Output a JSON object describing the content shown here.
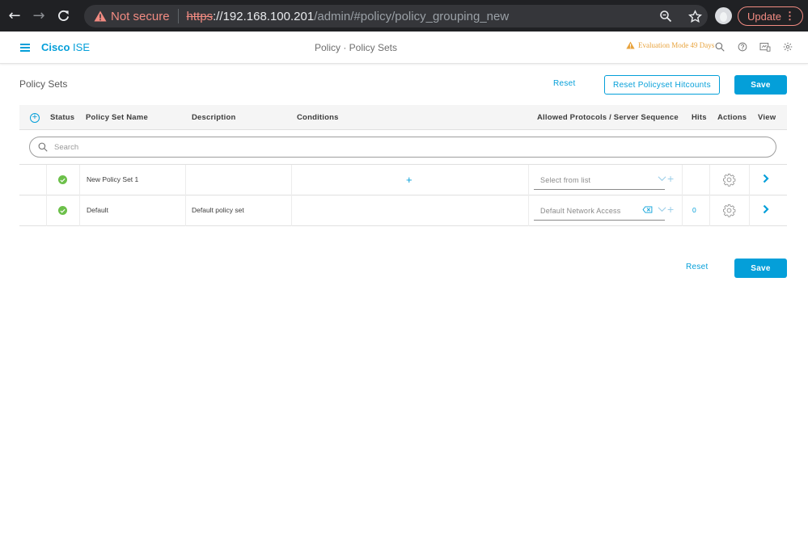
{
  "browser": {
    "not_secure": "Not secure",
    "url_scheme": "https",
    "url_host": "://192.168.100.201",
    "url_path": "/admin/#policy/policy_grouping_new",
    "update_label": "Update"
  },
  "header": {
    "brand_bold": "Cisco",
    "brand_light": "ISE",
    "breadcrumb": "Policy · Policy Sets",
    "eval_notice": "Evaluation Mode 49 Days"
  },
  "toolbar": {
    "title": "Policy Sets",
    "reset_label": "Reset",
    "reset_hitcounts_label": "Reset Policyset Hitcounts",
    "save_label": "Save"
  },
  "table": {
    "columns": {
      "status": "Status",
      "name": "Policy Set Name",
      "description": "Description",
      "conditions": "Conditions",
      "protocols": "Allowed Protocols / Server Sequence",
      "hits": "Hits",
      "actions": "Actions",
      "view": "View"
    },
    "search_placeholder": "Search",
    "rows": [
      {
        "name": "New Policy Set 1",
        "description": "",
        "protocol": "Select from list",
        "hits": ""
      },
      {
        "name": "Default",
        "description": "Default policy set",
        "protocol": "Default Network Access",
        "hits": "0"
      }
    ]
  },
  "footer": {
    "reset_label": "Reset",
    "save_label": "Save"
  },
  "colors": {
    "accent": "#049fd9",
    "status_ok": "#6cc04a",
    "warning": "#e8a33d"
  }
}
